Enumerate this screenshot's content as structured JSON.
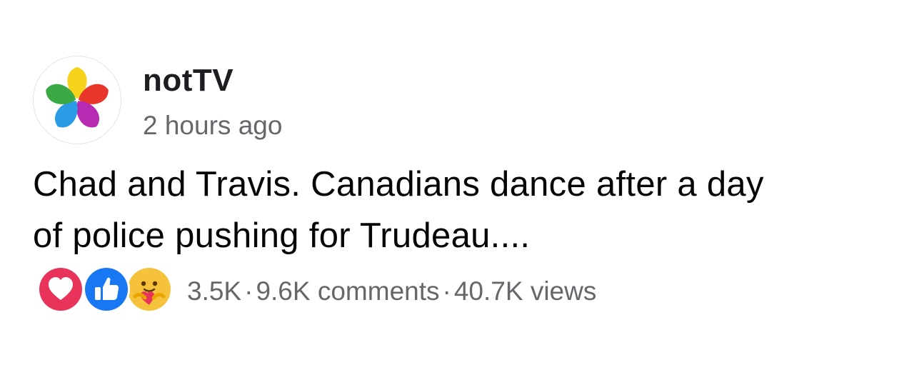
{
  "post": {
    "author": "notTV",
    "timestamp": "2 hours ago",
    "text_line1": "Chad and Travis. Canadians dance after a day",
    "text_line2": "of police pushing for Trudeau....",
    "reactions": {
      "icons": [
        "love-icon",
        "like-icon",
        "care-icon"
      ],
      "count": "3.5K"
    },
    "separator": "·",
    "comments": "9.6K comments",
    "views": "40.7K views"
  },
  "colors": {
    "author_text": "#1c1e21",
    "meta_text": "#65676b",
    "love": "#e8335a",
    "like": "#1877f2",
    "care": "#f7c23b",
    "avatar_yellow": "#f6d21a",
    "avatar_red": "#e8362a",
    "avatar_purple": "#b72ab2",
    "avatar_blue": "#2a9be4",
    "avatar_green": "#3aa845"
  }
}
